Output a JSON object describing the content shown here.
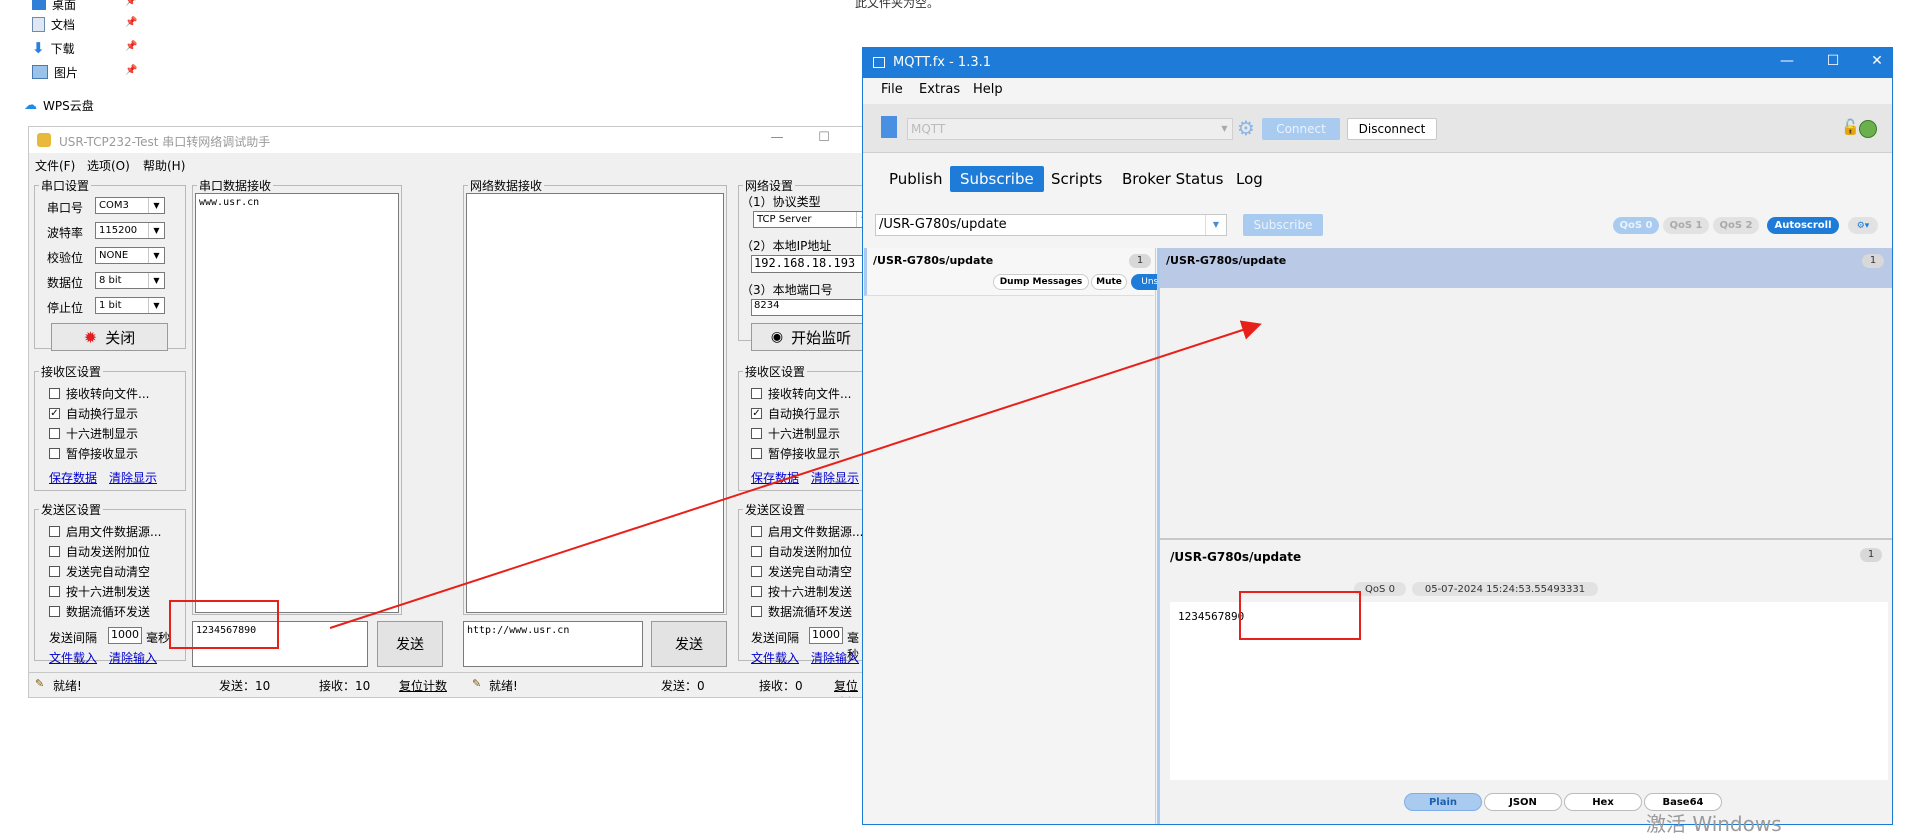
{
  "explorer": {
    "items": [
      {
        "label": "桌面",
        "icon": "desktop-icon"
      },
      {
        "label": "文档",
        "icon": "document-icon"
      },
      {
        "label": "下载",
        "icon": "download-icon"
      },
      {
        "label": "图片",
        "icon": "picture-icon"
      }
    ],
    "wps": "WPS云盘",
    "top_text": "此文件夹为空。"
  },
  "usr": {
    "title": "USR-TCP232-Test 串口转网络调试助手",
    "menu": [
      "文件(F)",
      "选项(O)",
      "帮助(H)"
    ],
    "serial_settings": {
      "legend": "串口设置",
      "port_label": "串口号",
      "port": "COM3",
      "baud_label": "波特率",
      "baud": "115200",
      "parity_label": "校验位",
      "parity": "NONE",
      "data_label": "数据位",
      "data": "8 bit",
      "stop_label": "停止位",
      "stop": "1 bit",
      "close_btn": "关闭"
    },
    "recv_settings": {
      "legend": "接收区设置",
      "options": [
        "接收转向文件...",
        "自动换行显示",
        "十六进制显示",
        "暂停接收显示"
      ],
      "checked": [
        false,
        true,
        false,
        false
      ],
      "save": "保存数据",
      "clear": "清除显示"
    },
    "send_settings": {
      "legend": "发送区设置",
      "options": [
        "启用文件数据源...",
        "自动发送附加位",
        "发送完自动清空",
        "按十六进制发送",
        "数据流循环发送"
      ],
      "interval_label": "发送间隔",
      "interval": "1000",
      "interval_unit": "毫秒",
      "load": "文件载入",
      "clear": "清除输入"
    },
    "serial_recv": {
      "legend": "串口数据接收",
      "content": "www.usr.cn"
    },
    "net_recv": {
      "legend": "网络数据接收",
      "content": ""
    },
    "serial_send": {
      "content": "1234567890",
      "btn": "发送"
    },
    "net_send": {
      "content": "http://www.usr.cn",
      "btn": "发送"
    },
    "net_settings": {
      "legend": "网络设置",
      "proto_label": "（1）协议类型",
      "proto": "TCP Server",
      "ip_label": "（2）本地IP地址",
      "ip": "192.168.18.193",
      "port_label": "（3）本地端口号",
      "port": "8234",
      "listen_btn": "开始监听"
    },
    "status": {
      "left": "就绪!",
      "sent": "发送：10",
      "recv": "接收：10",
      "reset": "复位计数",
      "right": "就绪!",
      "sent2": "发送：0",
      "recv2": "接收：0",
      "reset2": "复位计数"
    }
  },
  "mqtt": {
    "title": "MQTT.fx - 1.3.1",
    "menu": [
      "File",
      "Extras",
      "Help"
    ],
    "profile": "MQTT",
    "connect": "Connect",
    "disconnect": "Disconnect",
    "tabs": [
      "Publish",
      "Subscribe",
      "Scripts",
      "Broker Status",
      "Log"
    ],
    "active_tab": "Subscribe",
    "topic_input": "/USR-G780s/update",
    "subscribe_btn": "Subscribe",
    "qos": [
      "QoS 0",
      "QoS 1",
      "QoS 2"
    ],
    "autoscroll": "Autoscroll",
    "sub_item": {
      "topic": "/USR-G780s/update",
      "count": "1",
      "dump": "Dump Messages",
      "mute": "Mute",
      "unsubscribe": "Unsubscribe"
    },
    "msg_item": {
      "topic": "/USR-G780s/update",
      "count": "1"
    },
    "detail": {
      "topic": "/USR-G780s/update",
      "count": "1",
      "qos": "QoS 0",
      "timestamp": "05-07-2024  15:24:53.55493331",
      "payload": "1234567890"
    },
    "formats": [
      "Plain",
      "JSON",
      "Hex",
      "Base64"
    ],
    "watermark": "激活 Windows"
  },
  "colors": {
    "mqtt_blue": "#1e7bd7",
    "arrow_red": "#e8201a",
    "selected_row": "#b9c9e6"
  }
}
